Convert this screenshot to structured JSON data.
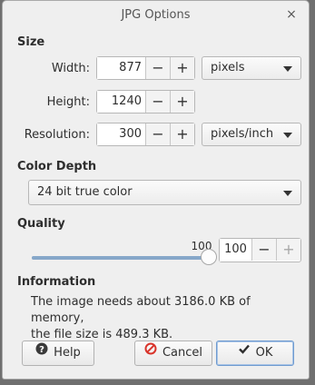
{
  "window": {
    "title": "JPG Options",
    "close_glyph": "×"
  },
  "size": {
    "heading": "Size",
    "width": {
      "label": "Width:",
      "value": "877",
      "unit": "pixels"
    },
    "height": {
      "label": "Height:",
      "value": "1240"
    },
    "resolution": {
      "label": "Resolution:",
      "value": "300",
      "unit": "pixels/inch"
    }
  },
  "color_depth": {
    "heading": "Color Depth",
    "selected": "24 bit true color"
  },
  "quality": {
    "heading": "Quality",
    "slider_label": "100",
    "value": "100",
    "level_percent": 100
  },
  "information": {
    "heading": "Information",
    "line1": "The image needs about 3186.0 KB of memory,",
    "line2": "the file size is 489.3 KB."
  },
  "buttons": {
    "help": "Help",
    "cancel": "Cancel",
    "ok": "OK"
  },
  "spin": {
    "minus": "−",
    "plus": "+"
  },
  "colors": {
    "slider_fill": "#86a7c9",
    "cancel_icon": "#d9342b"
  }
}
